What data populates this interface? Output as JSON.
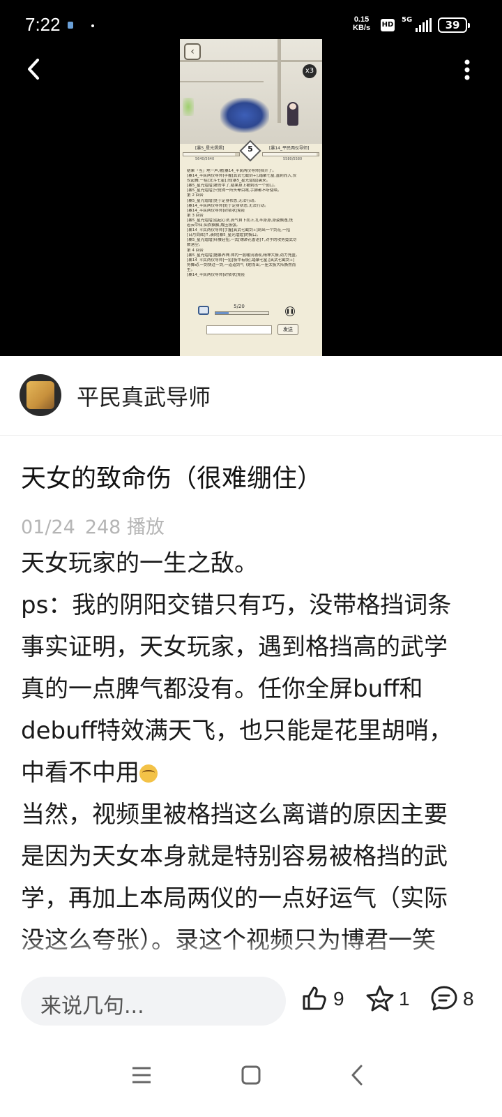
{
  "status_bar": {
    "time": "7:22",
    "net_speed_value": "0.15",
    "net_speed_unit": "KB/s",
    "hd_label": "HD",
    "network_label": "5G",
    "battery_level": "39"
  },
  "video": {
    "game": {
      "speed_label": "x3",
      "vs_round": "5",
      "left_fighter_name": "[暴5_星光熠熠]",
      "right_fighter_name": "[暴14_平民两仪导师]",
      "left_hp_text": "5640/5640",
      "right_hp_text": "5580/5580",
      "left_hp_fraction": 0.92,
      "right_hp_fraction": 0.96,
      "progress_label": "5/20",
      "progress_fraction": 0.25,
      "send_label": "发送",
      "log_lines": [
        "结果「当」地一声,被[暴14_平民两仪导师]挡开了。",
        "[暴14_平民两仪导师]手握[真武七截剑+],踏聚七星,直刺而入,仪",
        "仪起舞,一招[北斗七星],向[暴5_星光熠熠]袭来。",
        "[暴5_星光熠熠]被击中了,结果身上被刺出一个创口。",
        "[暴5_星光熠熠]只觉得一阵头晕目眩,手脚都不听使唤。",
        "第 2 回合",
        "[暴5_星光熠熠]处于定身状态,无法行动。",
        "[暴14_平民两仪导师]处于定身状态,无法行动。",
        "[暴14_平民两仪导师]封锁状|免疫",
        "第 3 回合",
        "[暴5_星光熠熠]运起心法,真气自下而上,扎半身身,身姿飘逸,恍",
        "若云中仙,仙衣飘飘,威压极强。",
        "[暴14_平民两仪导师]手握[真武七截剑+]刺出一个剑花,一招",
        "[日月同辉]↑,袭向[暴5_星光熠熠]的胸口。",
        "[暴5_星光熠熠]纤腰轻扭,一式[缥渺花香语]↑,对手的攻势竟式尽",
        "数落空。",
        "第 4 回合",
        "[暴5_星光熠熠]施暴养神,体内一股暖流涌现,精神大振,劲力充盈。",
        "[暴14_平民两仪导师]一招[极中有极],踏聚七星,[真武七截剑+]",
        "势舞动,一剑快过一剑,一道道剑气飞射而出,一座太极大阵撕然而",
        "生。",
        "[暴14_平民两仪导师]封锁状|免疫"
      ]
    }
  },
  "author": {
    "name": "平民真武导师"
  },
  "post": {
    "title": "天女的致命伤（很难绷住）",
    "date": "01/24",
    "plays": "248 播放",
    "lines": [
      "天女玩家的一生之敌。",
      "ps：我的阴阳交错只有巧，没带格挡词条",
      "事实证明，天女玩家，遇到格挡高的武学",
      "真的一点脾气都没有。任你全屏buff和",
      "debuff特效满天飞，也只能是花里胡哨，",
      "中看不中用",
      "当然，视频里被格挡这么离谱的原因主要",
      "是因为天女本身就是特别容易被格挡的武",
      "学，再加上本局两仪的一点好运气（实际",
      "没这么夸张）。录这个视频只为博君一笑"
    ]
  },
  "actions": {
    "comment_placeholder": "来说几句...",
    "like_count": "9",
    "favorite_count": "1",
    "comment_count": "8"
  },
  "colors": {
    "video_bg": "#000000",
    "page_bg": "#ffffff",
    "meta_gray": "#b5b5b5",
    "input_bg": "#f2f3f5"
  },
  "icons": {
    "back": "chevron-left-icon",
    "more": "more-vertical-icon",
    "like": "thumbs-up-icon",
    "favorite": "star-icon",
    "comment": "comment-bubble-icon",
    "nav_menu": "menu-icon",
    "nav_home": "square-home-icon",
    "nav_back": "nav-back-icon"
  }
}
